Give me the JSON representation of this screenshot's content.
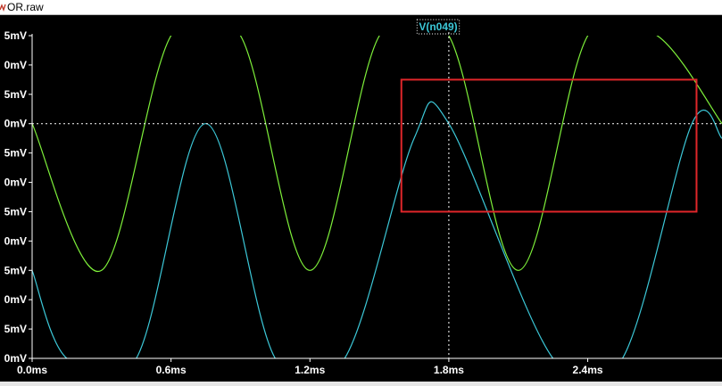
{
  "window": {
    "title": "OR.raw",
    "icon": "waveform-file-icon"
  },
  "colors": {
    "background": "#000000",
    "axis": "#ffffff",
    "green_trace": "#7ef03a",
    "cyan_trace": "#3cc8d8",
    "trace_label": "#3cc8d8",
    "annotation_box": "#e0262a",
    "cursor": "#ffffff"
  },
  "chart_data": {
    "type": "line",
    "title": "V(n049)",
    "xlabel": "",
    "ylabel": "",
    "grid": false,
    "x_ticks": [
      {
        "value": 0.0,
        "label": "0.0ms"
      },
      {
        "value": 0.6,
        "label": "0.6ms"
      },
      {
        "value": 1.2,
        "label": "1.2ms"
      },
      {
        "value": 1.8,
        "label": "1.8ms"
      },
      {
        "value": 2.4,
        "label": "2.4ms"
      }
    ],
    "y_tick_labels": [
      "5mV",
      "0mV",
      "5mV",
      "0mV",
      "5mV",
      "0mV",
      "5mV",
      "0mV",
      "5mV",
      "0mV",
      "5mV",
      "0mV"
    ],
    "xlim": [
      0.0,
      2.98
    ],
    "ylim": [
      0,
      11
    ],
    "series": [
      {
        "color": "#7ef03a",
        "x": [
          0.0,
          0.3,
          0.6,
          0.9,
          1.2,
          1.5,
          1.8,
          2.1,
          2.4,
          2.7,
          2.98
        ],
        "y": [
          8.0,
          3.0,
          11.0,
          11.0,
          3.0,
          11.0,
          11.0,
          3.0,
          11.0,
          11.0,
          8.0
        ],
        "clipped_at_top": true
      },
      {
        "color": "#3cc8d8",
        "x": [
          0.0,
          0.15,
          0.45,
          0.75,
          1.05,
          1.35,
          1.65,
          1.8,
          2.25,
          2.55,
          2.85,
          2.98
        ],
        "y": [
          3.0,
          0.0,
          0.0,
          8.0,
          0.0,
          0.0,
          7.5,
          8.0,
          0.0,
          0.0,
          8.0,
          7.5
        ],
        "clipped_at_bottom": true
      }
    ],
    "cursor": {
      "x": 1.8,
      "y": 8.0
    },
    "annotation_box": {
      "x_range": [
        1.595,
        2.87
      ],
      "y_range": [
        5.0,
        9.5
      ]
    }
  }
}
